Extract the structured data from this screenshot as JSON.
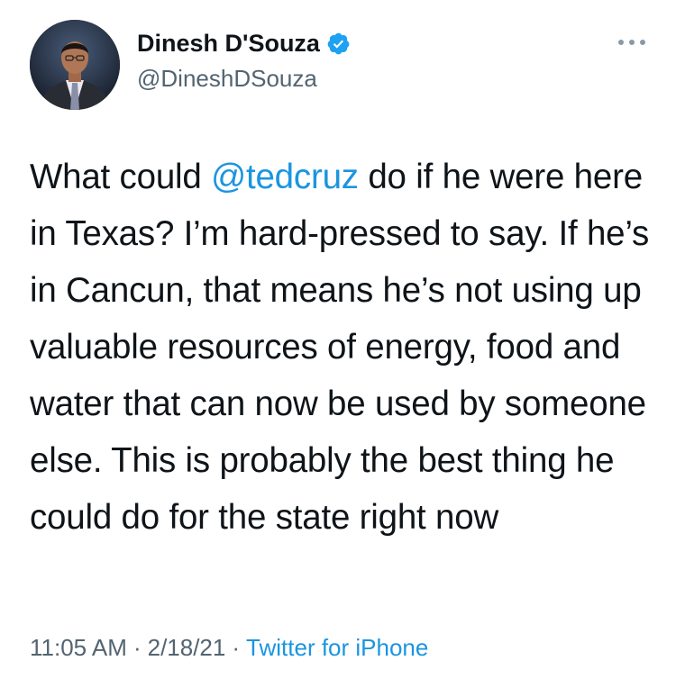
{
  "author": {
    "display_name": "Dinesh D'Souza",
    "handle": "@DineshDSouza",
    "verified": true
  },
  "icons": {
    "verified": "verified-badge-icon",
    "more": "more-options-icon"
  },
  "tweet": {
    "text_before": "What could ",
    "mention": "@tedcruz",
    "text_after": " do if he were here in Texas? I’m hard-pressed to say. If he’s in Cancun, that means he’s not using up valuable resources of energy, food and water that can now be used by someone else. This is probably the best thing he could do for the state right now",
    "time": "11:05 AM",
    "date": "2/18/21",
    "separator": "·",
    "source": "Twitter for iPhone"
  },
  "colors": {
    "link": "#1b95e0",
    "secondary_text": "#536471",
    "primary_text": "#0f1419",
    "verified_badge": "#1da1f2"
  }
}
